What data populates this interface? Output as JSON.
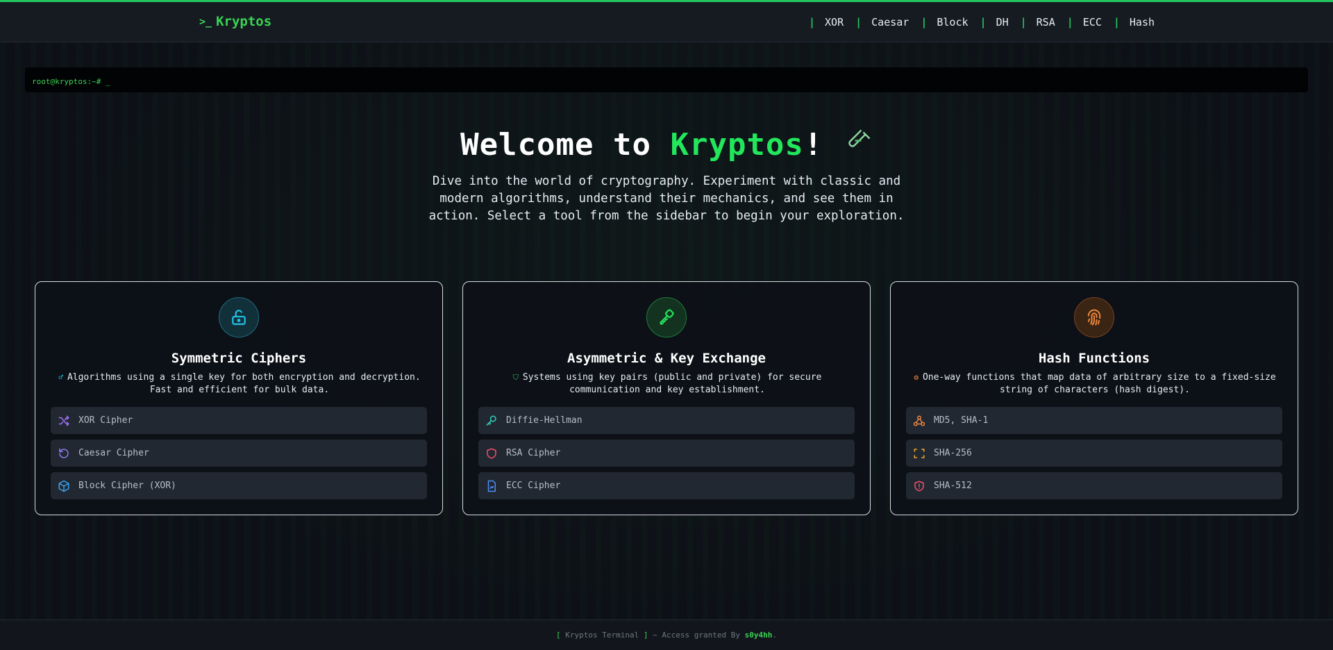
{
  "brand": {
    "prompt": ">_",
    "name": "Kryptos"
  },
  "nav": {
    "separator": "|",
    "links": [
      "XOR",
      "Caesar",
      "Block",
      "DH",
      "RSA",
      "ECC",
      "Hash"
    ]
  },
  "terminal": {
    "prompt": "root@kryptos:~# _"
  },
  "hero": {
    "title_prefix": "Welcome to ",
    "title_accent": "Kryptos",
    "title_suffix": "!",
    "description": "Dive into the world of cryptography. Experiment with classic and modern algorithms, understand their mechanics, and see them in action. Select a tool from the sidebar to begin your exploration."
  },
  "cards": [
    {
      "title": "Symmetric Ciphers",
      "description": "Algorithms using a single key for both encryption and decryption. Fast and efficient for bulk data.",
      "accent": "#22c3e6",
      "items": [
        "XOR Cipher",
        "Caesar Cipher",
        "Block Cipher (XOR)"
      ]
    },
    {
      "title": "Asymmetric & Key Exchange",
      "description": "Systems using key pairs (public and private) for secure communication and key establishment.",
      "accent": "#22c55e",
      "items": [
        "Diffie-Hellman",
        "RSA Cipher",
        "ECC Cipher"
      ]
    },
    {
      "title": "Hash Functions",
      "description": "One-way functions that map data of arbitrary size to a fixed-size string of characters (hash digest).",
      "accent": "#f0883e",
      "items": [
        "MD5, SHA-1",
        "SHA-256",
        "SHA-512"
      ]
    }
  ],
  "footer": {
    "open": "[",
    "label": " Kryptos Terminal ",
    "close": "]",
    "text": " ~ Access granted By ",
    "author": "s0y4hh",
    "end": "."
  },
  "colors": {
    "accent_green": "#22c55e",
    "background": "#0d1117"
  }
}
